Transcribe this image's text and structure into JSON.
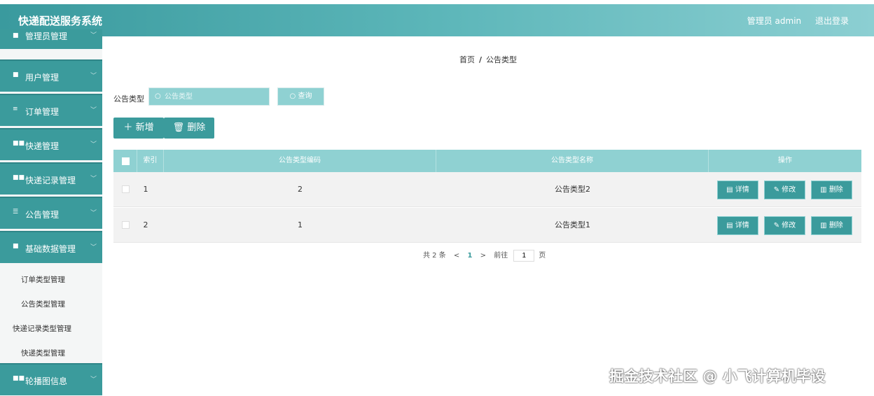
{
  "header": {
    "title": "快递配送服务系统",
    "admin_label": "管理员 admin",
    "logout_label": "退出登录"
  },
  "sidebar": {
    "menus": [
      {
        "label": "管理员管理",
        "icon": "user-icon"
      },
      {
        "label": "用户管理",
        "icon": "user-icon"
      },
      {
        "label": "订单管理",
        "icon": "list-icon"
      },
      {
        "label": "快递管理",
        "icon": "grid-icon"
      },
      {
        "label": "快递记录管理",
        "icon": "grid-icon"
      },
      {
        "label": "公告管理",
        "icon": "notice-icon"
      },
      {
        "label": "基础数据管理",
        "icon": "doc-icon"
      },
      {
        "label": "轮播图信息",
        "icon": "grid-icon"
      }
    ],
    "submenu": [
      "订单类型管理",
      "公告类型管理",
      "快递记录类型管理",
      "快递类型管理"
    ]
  },
  "breadcrumb": {
    "home": "首页",
    "sep": "/",
    "current": "公告类型"
  },
  "search": {
    "label": "公告类型",
    "placeholder": "公告类型",
    "query_button": "查询"
  },
  "toolbar": {
    "add_label": "新增",
    "delete_label": "删除"
  },
  "table": {
    "headers": [
      "索引",
      "公告类型编码",
      "公告类型名称",
      "操作"
    ],
    "rows": [
      {
        "index": "1",
        "code": "2",
        "name": "公告类型2"
      },
      {
        "index": "2",
        "code": "1",
        "name": "公告类型1"
      }
    ],
    "actions": {
      "detail": "详情",
      "edit": "修改",
      "delete": "删除"
    }
  },
  "pagination": {
    "total": "共 2 条",
    "prev": "<",
    "page": "1",
    "next": ">",
    "goto_label": "前往",
    "goto_value": "1",
    "page_unit": "页"
  },
  "watermark": "掘金技术社区 @ 小飞计算机毕设",
  "colors": {
    "primary": "#3b9b9c",
    "light": "#8fd1d2"
  }
}
